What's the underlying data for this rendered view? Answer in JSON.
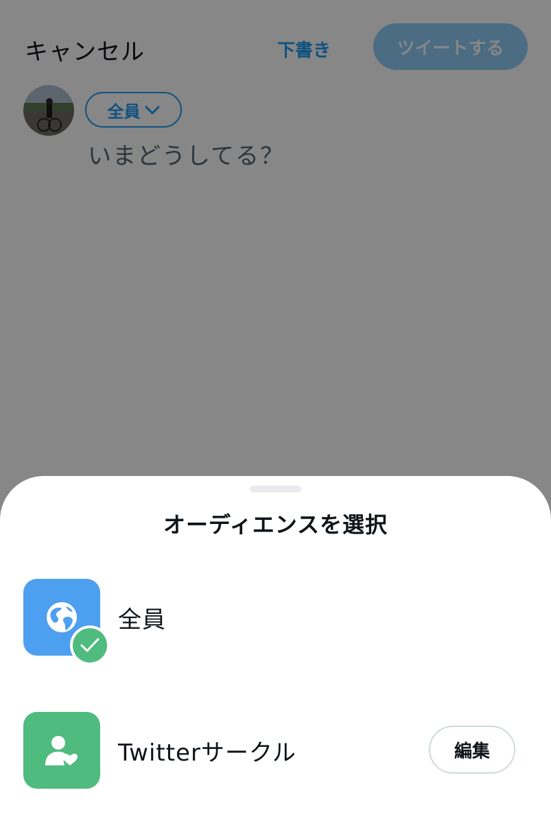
{
  "header": {
    "cancel_label": "キャンセル",
    "draft_label": "下書き",
    "tweet_label": "ツイートする"
  },
  "composer": {
    "audience_label": "全員",
    "placeholder": "いまどうしてる？"
  },
  "sheet": {
    "title": "オーディエンスを選択",
    "options": [
      {
        "label": "全員",
        "icon": "globe-icon",
        "selected": true
      },
      {
        "label": "Twitterサークル",
        "icon": "circle-people-icon",
        "selected": false,
        "edit_label": "編集"
      }
    ]
  },
  "colors": {
    "accent": "#1d9bf0",
    "everyone_icon_bg": "#4d9ff0",
    "circle_icon_bg": "#4fbb7f",
    "check_bg": "#4fbb7f"
  }
}
